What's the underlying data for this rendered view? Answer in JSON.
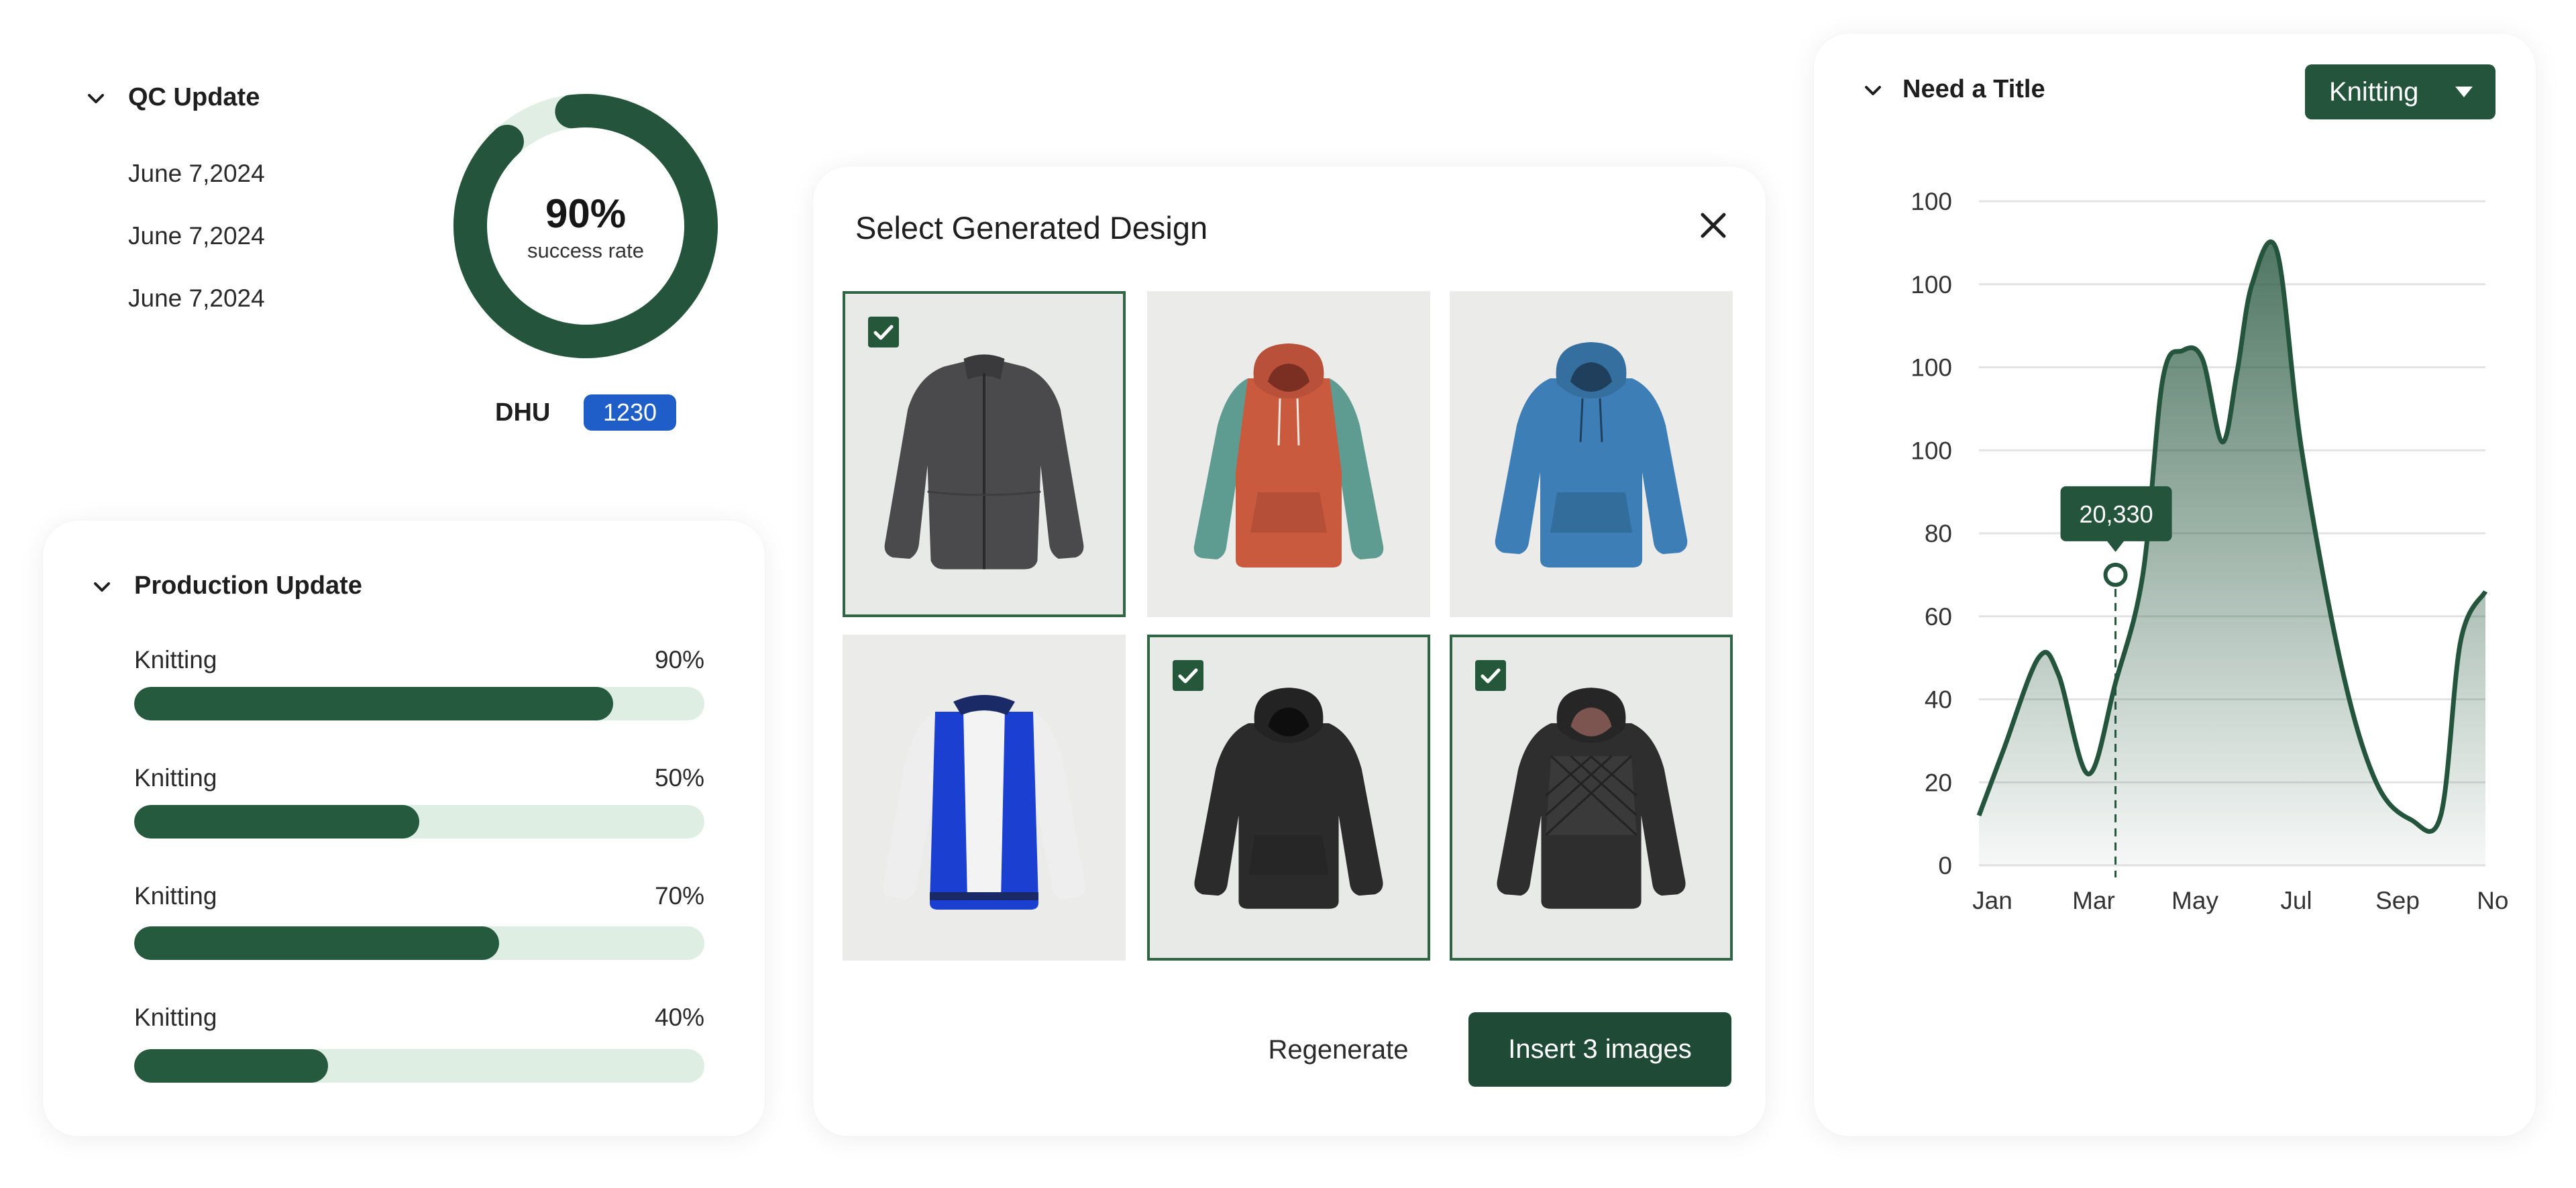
{
  "colors": {
    "accent": "#24553c",
    "accent_light": "#dfeee3",
    "badge_blue": "#1f5ec8",
    "tile_bg": "#ebebea"
  },
  "qc": {
    "title": "QC Update",
    "dates": [
      "June 7,2024",
      "June 7,2024",
      "June 7,2024"
    ],
    "success_value": "90%",
    "success_label": "success rate",
    "success_fraction": 0.9,
    "dhu_label": "DHU",
    "dhu_value": "1230"
  },
  "production": {
    "title": "Production Update",
    "rows": [
      {
        "label": "Knitting",
        "percent_text": "90%",
        "value": 84
      },
      {
        "label": "Knitting",
        "percent_text": "50%",
        "value": 50
      },
      {
        "label": "Knitting",
        "percent_text": "70%",
        "value": 64
      },
      {
        "label": "Knitting",
        "percent_text": "40%",
        "value": 34
      }
    ]
  },
  "modal": {
    "title": "Select Generated Design",
    "close_icon": "close-icon",
    "tiles": [
      {
        "name": "grey-zip-jacket",
        "selected": true
      },
      {
        "name": "red-teal-hoodie",
        "selected": false
      },
      {
        "name": "blue-hoodie",
        "selected": false
      },
      {
        "name": "blue-varsity-jacket",
        "selected": false
      },
      {
        "name": "black-hoodie",
        "selected": true
      },
      {
        "name": "black-quilted-hoodie",
        "selected": true
      }
    ],
    "regenerate_label": "Regenerate",
    "insert_label": "Insert 3 images"
  },
  "chart_card": {
    "title": "Need a Title",
    "dropdown_value": "Knitting",
    "dropdown_icon": "caret-down-icon"
  },
  "chart_data": {
    "type": "area",
    "title": "",
    "xlabel": "",
    "ylabel": "",
    "x_tick_labels": [
      "Jan",
      "Mar",
      "May",
      "Jul",
      "Sep",
      "Nov"
    ],
    "y_tick_labels": [
      "0",
      "20",
      "40",
      "60",
      "80",
      "100",
      "100",
      "100",
      "100"
    ],
    "grid": true,
    "series": [
      {
        "x": [
          0,
          0.5,
          1.2,
          1.6,
          2.2,
          2.75,
          3.3,
          3.7,
          4.1,
          4.5,
          4.9,
          5.2,
          5.5,
          6.0,
          6.5,
          7.3,
          8.0,
          8.7,
          9.3,
          9.7,
          10.2
        ],
        "y": [
          12,
          28,
          50,
          46,
          22,
          44,
          70,
          117,
          124,
          122,
          102,
          119,
          140,
          148,
          100,
          48,
          20,
          11,
          12,
          54,
          66
        ]
      }
    ],
    "annotation": {
      "x": 2.75,
      "y": 70,
      "label": "20,330",
      "dashed_drop_line": true
    },
    "ylim": [
      0,
      160
    ],
    "xlim": [
      0,
      10.2
    ]
  }
}
